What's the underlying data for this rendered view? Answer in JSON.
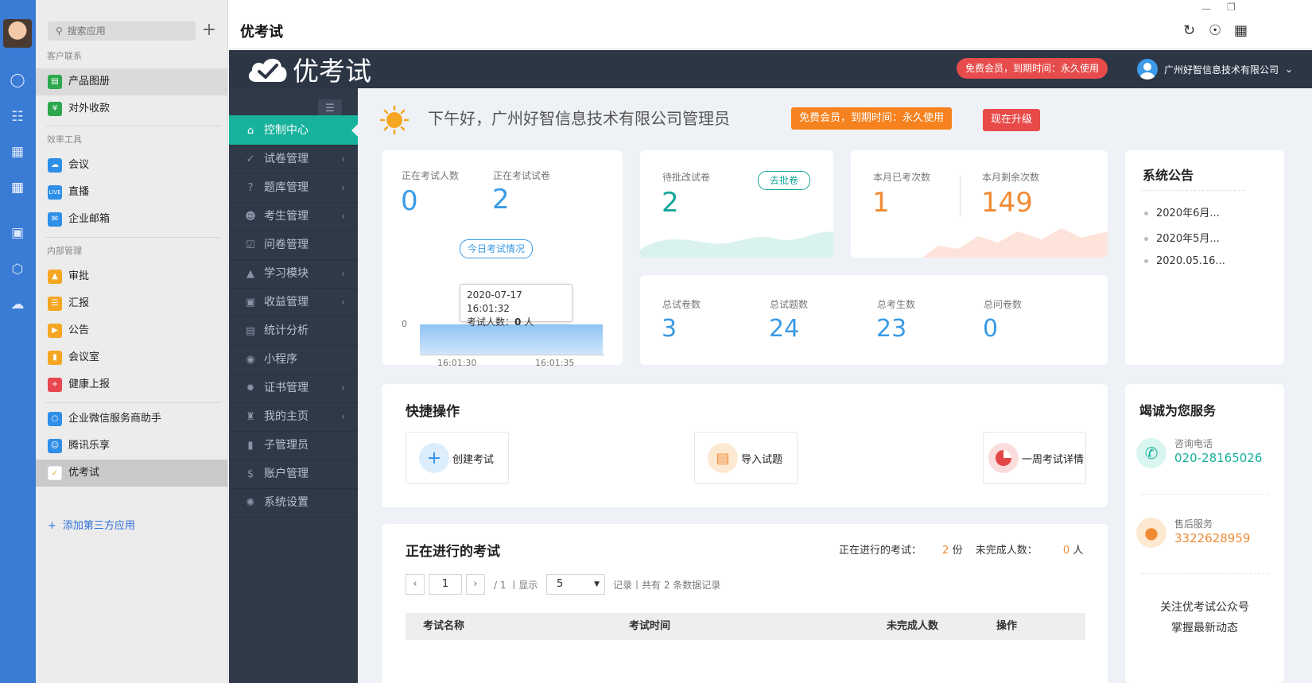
{
  "apps_panel": {
    "search_placeholder": "搜索应用",
    "groups": [
      "客户联系",
      "效率工具",
      "内部管理"
    ],
    "items": [
      {
        "label": "产品图册",
        "icon": "book-icon",
        "color": "#2ea84f"
      },
      {
        "label": "对外收款",
        "icon": "shield-yen-icon",
        "color": "#2ea84f"
      },
      {
        "label": "会议",
        "icon": "cloud-meeting-icon",
        "color": "#2f8fe8"
      },
      {
        "label": "直播",
        "icon": "live-icon",
        "color": "#2f8fe8"
      },
      {
        "label": "企业邮箱",
        "icon": "mail-icon",
        "color": "#2f8fe8"
      },
      {
        "label": "审批",
        "icon": "stamp-icon",
        "color": "#f5a623"
      },
      {
        "label": "汇报",
        "icon": "report-icon",
        "color": "#f5a623"
      },
      {
        "label": "公告",
        "icon": "megaphone-icon",
        "color": "#f5a623"
      },
      {
        "label": "会议室",
        "icon": "door-icon",
        "color": "#f5a623"
      },
      {
        "label": "健康上报",
        "icon": "health-icon",
        "color": "#e8474f"
      },
      {
        "label": "企业微信服务商助手",
        "icon": "chat-assistant-icon",
        "color": "#2f8fe8"
      },
      {
        "label": "腾讯乐享",
        "icon": "tencent-lexiang-icon",
        "color": "#2f8fe8"
      },
      {
        "label": "优考试",
        "icon": "youkaoshi-icon",
        "color": "#f5a623"
      }
    ],
    "add_third_party": "添加第三方应用"
  },
  "titlebar": {
    "title": "优考试"
  },
  "header": {
    "logo_text": "优考试",
    "membership_pill": "免费会员，到期时间：永久使用",
    "user_name": "广州好智信息技术有限公司"
  },
  "nav": {
    "items": [
      {
        "label": "控制中心",
        "icon": "home-icon",
        "active": true,
        "arrow": false
      },
      {
        "label": "试卷管理",
        "icon": "check-circle-icon",
        "arrow": true
      },
      {
        "label": "题库管理",
        "icon": "question-circle-icon",
        "arrow": true
      },
      {
        "label": "考生管理",
        "icon": "user-icon",
        "arrow": true
      },
      {
        "label": "问卷管理",
        "icon": "checkbox-icon",
        "arrow": false
      },
      {
        "label": "学习模块",
        "icon": "graduation-cap-icon",
        "arrow": true
      },
      {
        "label": "收益管理",
        "icon": "money-icon",
        "arrow": true
      },
      {
        "label": "统计分析",
        "icon": "bar-chart-icon",
        "arrow": false
      },
      {
        "label": "小程序",
        "icon": "wechat-icon",
        "arrow": false
      },
      {
        "label": "证书管理",
        "icon": "certificate-icon",
        "arrow": true
      },
      {
        "label": "我的主页",
        "icon": "stamp-icon",
        "arrow": true
      },
      {
        "label": "子管理员",
        "icon": "lock-icon",
        "arrow": false
      },
      {
        "label": "账户管理",
        "icon": "dollar-icon",
        "arrow": false
      },
      {
        "label": "系统设置",
        "icon": "gear-icon",
        "arrow": false
      }
    ]
  },
  "greeting": {
    "text": "下午好，广州好智信息技术有限公司管理员",
    "membership_badge": "免费会员，到期时间：永久使用",
    "upgrade_button": "现在升级"
  },
  "stats": {
    "ongoing_people_label": "正在考试人数",
    "ongoing_people": "0",
    "ongoing_papers_label": "正在考试试卷",
    "ongoing_papers": "2",
    "today_button": "今日考试情况",
    "tooltip_time": "2020-07-17 16:01:32",
    "tooltip_label": "考试人数：",
    "tooltip_value": "0",
    "tooltip_unit": "人",
    "axis_zero": "0",
    "axis_ticks": [
      "16:01:30",
      "16:01:35"
    ],
    "pending_label": "待批改试卷",
    "pending_value": "2",
    "pending_button": "去批卷",
    "month_done_label": "本月已考次数",
    "month_done": "1",
    "month_left_label": "本月剩余次数",
    "month_left": "149",
    "total_papers_label": "总试卷数",
    "total_papers": "3",
    "total_questions_label": "总试题数",
    "total_questions": "24",
    "total_students_label": "总考生数",
    "total_students": "23",
    "total_surveys_label": "总问卷数",
    "total_surveys": "0"
  },
  "notice": {
    "title": "系统公告",
    "items": [
      "2020年6月...",
      "2020年5月...",
      "2020.05.16..."
    ]
  },
  "quick": {
    "title": "快捷操作",
    "actions": [
      {
        "label": "创建考试",
        "icon": "plus-icon"
      },
      {
        "label": "导入试题",
        "icon": "document-icon"
      },
      {
        "label": "一周考试详情",
        "icon": "pie-chart-icon"
      }
    ]
  },
  "service": {
    "title": "竭诚为您服务",
    "phone_label": "咨询电话",
    "phone": "020-28165026",
    "after_label": "售后服务",
    "after_qq": "3322628959",
    "follow_line1": "关注优考试公众号",
    "follow_line2": "掌握最新动态"
  },
  "ongoing": {
    "title": "正在进行的考试",
    "summary_label": "正在进行的考试：",
    "summary_count": "2",
    "summary_unit": "份",
    "unfinished_label": "未完成人数：",
    "unfinished_count": "0",
    "unfinished_unit": "人",
    "page_value": "1",
    "page_total": "/ 1 丨显示",
    "page_size": "5",
    "record_text": "记录丨共有 2 条数据记录",
    "columns": [
      "考试名称",
      "考试时间",
      "未完成人数",
      "操作"
    ]
  },
  "colors": {
    "accent": "#16b29c",
    "nav_bg": "#2f3947",
    "header_bg": "#2c3645",
    "rail": "#3a7bd5"
  }
}
